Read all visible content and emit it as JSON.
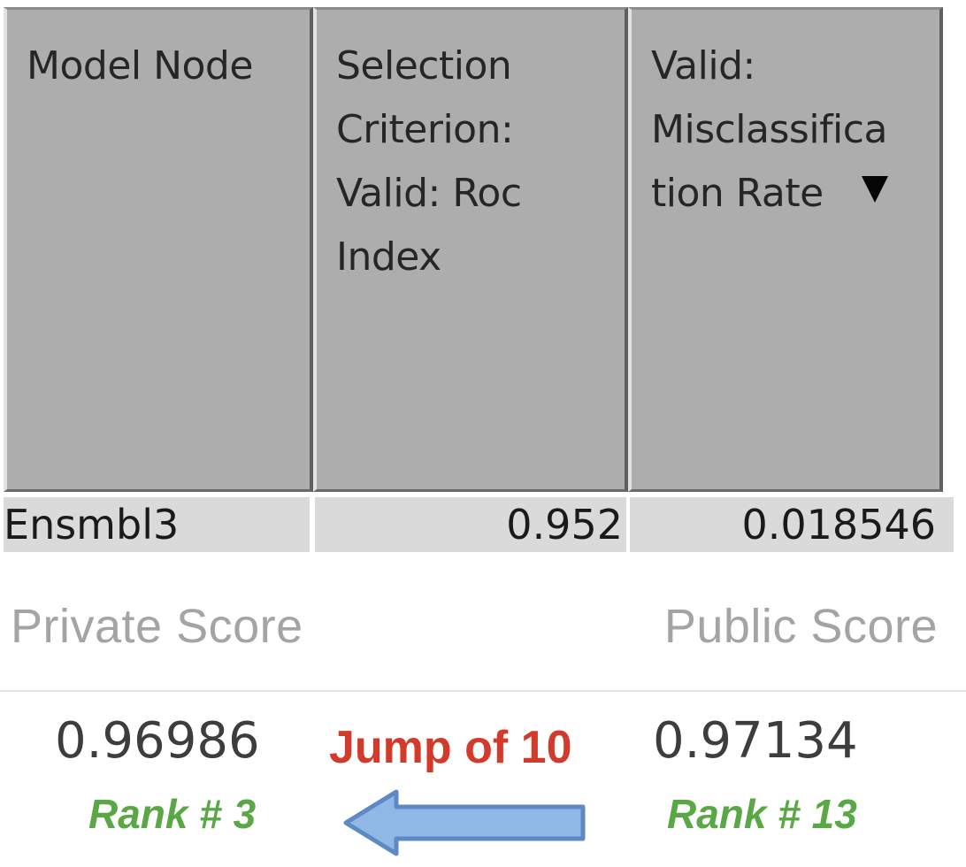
{
  "table": {
    "columns": [
      {
        "label": "Model Node"
      },
      {
        "label": "Selection\nCriterion:\nValid: Roc\nIndex"
      },
      {
        "label": "Valid:\nMisclassifica\ntion Rate",
        "sort": "descending"
      }
    ],
    "rows": [
      {
        "model_node": "Ensmbl3",
        "roc_index": "0.952",
        "misclassification_rate": "0.018546"
      }
    ]
  },
  "scores": {
    "private": {
      "header": "Private Score",
      "value": "0.96986",
      "rank": "Rank # 3"
    },
    "public": {
      "header": "Public Score",
      "value": "0.97134",
      "rank": "Rank # 13"
    },
    "jump_label": "Jump of 10",
    "arrow_icon": "left-arrow-icon"
  },
  "colors": {
    "header_bg": "#adadad",
    "row_bg": "#dadada",
    "score_header": "#a4a4a4",
    "jump": "#d23a2c",
    "rank": "#5aa845",
    "arrow_fill": "#8fb8e6",
    "arrow_stroke": "#5d89c4"
  }
}
